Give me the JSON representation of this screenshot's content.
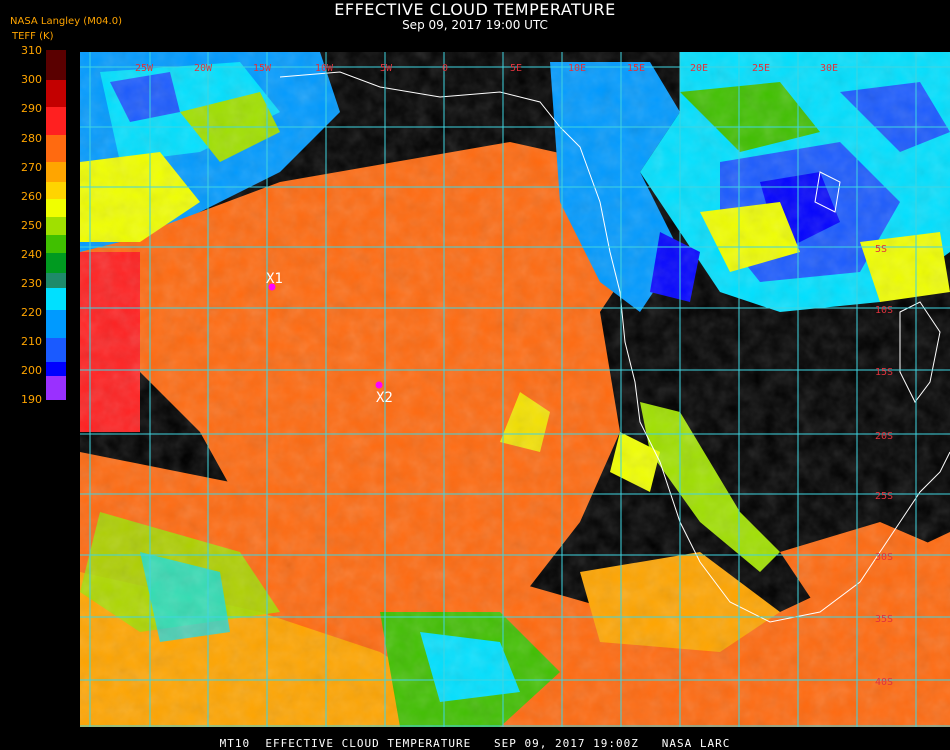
{
  "header": {
    "title": "EFFECTIVE CLOUD TEMPERATURE",
    "subtitle": "Sep 09, 2017 19:00 UTC",
    "credit": "NASA Langley (M04.0)",
    "unit": "TEFF (K)"
  },
  "colorbar": {
    "labels": [
      "310",
      "300",
      "290",
      "280",
      "270",
      "260",
      "250",
      "240",
      "230",
      "220",
      "210",
      "200",
      "190"
    ],
    "colors": [
      "#5a0000",
      "#c30000",
      "#ff2020",
      "#ff6a10",
      "#ffa500",
      "#ffd400",
      "#f0ff00",
      "#a0e000",
      "#40c000",
      "#009a20",
      "#1e8a6a",
      "#00e0ff",
      "#009aff",
      "#1a5aff",
      "#0000ff",
      "#9a30ff"
    ]
  },
  "map": {
    "lon_labels": [
      "25W",
      "20W",
      "15W",
      "10W",
      "5W",
      "0",
      "5E",
      "10E",
      "15E",
      "20E",
      "25E",
      "30E"
    ],
    "lat_labels": [
      "5S",
      "10S",
      "15S",
      "20S",
      "25S",
      "30S",
      "35S",
      "40S"
    ],
    "markers": [
      {
        "label": "X1",
        "color": "#ff00ff"
      },
      {
        "label": "X2",
        "color": "#ff00ff"
      }
    ]
  },
  "footer": {
    "text": "MT10  EFFECTIVE CLOUD TEMPERATURE   SEP 09, 2017 19:00Z   NASA LARC"
  }
}
